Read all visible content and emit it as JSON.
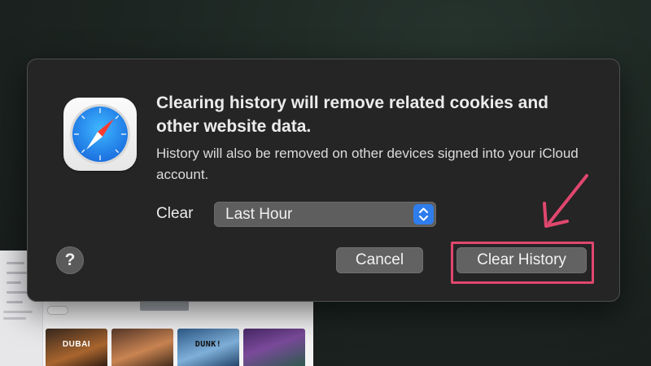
{
  "dialog": {
    "app_icon": "safari-compass-icon",
    "headline": "Clearing history will remove related cookies and other website data.",
    "message": "History will also be removed on other devices signed into your iCloud account.",
    "clear_label": "Clear",
    "range_select": {
      "value": "Last Hour",
      "stepper_icon": "up-down-chevron-icon"
    },
    "help_button": "?",
    "cancel_button": "Cancel",
    "clear_history_button": "Clear History"
  },
  "annotation": {
    "arrow_icon": "pink-arrow-icon",
    "highlight_color": "#e0476e"
  },
  "background_window": {
    "tiles": [
      {
        "name": "dubai",
        "caption": "DUBAI"
      },
      {
        "name": "portrait",
        "caption": ""
      },
      {
        "name": "dunk",
        "caption": "DUNK!"
      },
      {
        "name": "city",
        "caption": ""
      }
    ]
  },
  "colors": {
    "dialog_bg": "#252525",
    "accent_blue": "#2f7dec",
    "button_gray": "#626262"
  }
}
